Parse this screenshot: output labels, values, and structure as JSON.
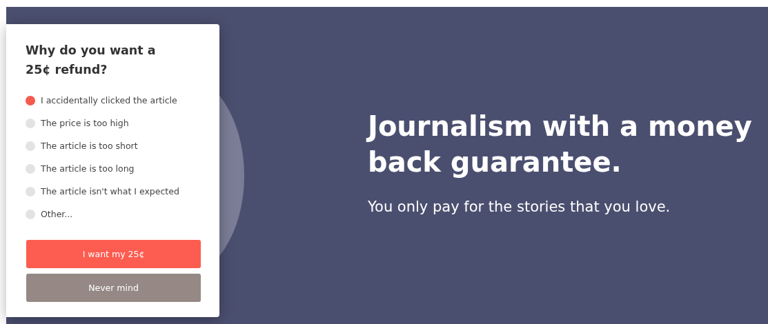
{
  "dialog": {
    "title": "Why do you want a 25¢ refund?",
    "options": [
      {
        "label": "I accidentally clicked the article",
        "selected": true
      },
      {
        "label": "The price is too high",
        "selected": false
      },
      {
        "label": "The article is too short",
        "selected": false
      },
      {
        "label": "The article is too long",
        "selected": false
      },
      {
        "label": "The article isn't what I expected",
        "selected": false
      },
      {
        "label": "Other...",
        "selected": false
      }
    ],
    "buttons": [
      {
        "label": "I want my 25¢",
        "kind": "primary"
      },
      {
        "label": "Never mind",
        "kind": "secondary"
      }
    ]
  },
  "hero": {
    "headline": "Journalism with a money back guarantee.",
    "subtitle": "You only pay for the stories that you love."
  }
}
